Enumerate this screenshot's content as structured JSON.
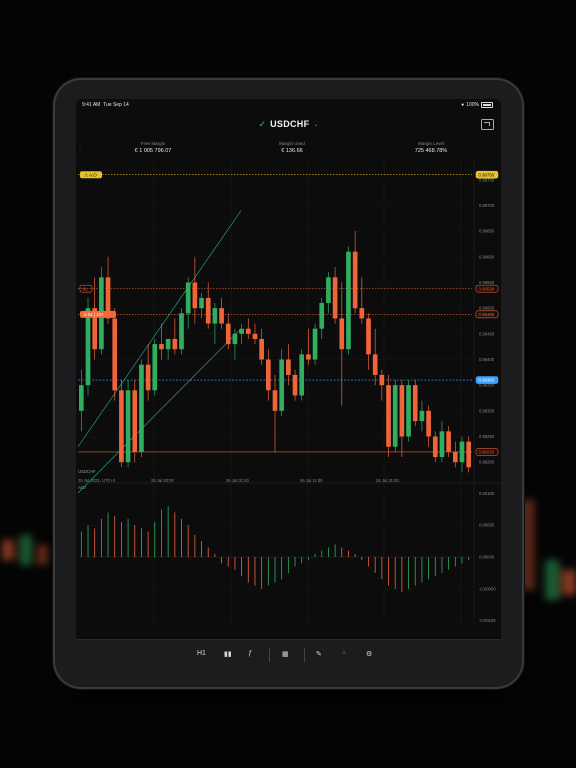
{
  "status": {
    "time": "9:41 AM",
    "date": "Tue Sep 14",
    "battery": "100%"
  },
  "header": {
    "symbol": "USDCHF"
  },
  "metrics": [
    {
      "label": "Free Margin",
      "value": "€ 1 005 796.07"
    },
    {
      "label": "Margin Used",
      "value": "€ 136.66"
    },
    {
      "label": "Margin Level",
      "value": "725 468.78%"
    }
  ],
  "chart_data": {
    "type": "candlestick",
    "price_axis": {
      "ticks": [
        "0.96750",
        "0.96700",
        "0.96650",
        "0.96600",
        "0.96550",
        "0.96500",
        "0.96450",
        "0.96400",
        "0.96350",
        "0.96300",
        "0.96250",
        "0.96200"
      ],
      "min": 0.96175,
      "max": 0.96775
    },
    "time_labels": [
      "25 Jul 2022, UTC+2",
      "25 Jul 20:00",
      "26 Jul 01:00",
      "26 Jul 11:00",
      "26 Jul 21:00"
    ],
    "markers": {
      "alert": {
        "label": "A:O",
        "price": 0.9676,
        "color": "#e6c229"
      },
      "sl": {
        "label": "SL",
        "price": 0.96538,
        "tag": "0.96538",
        "color": "#e0603a"
      },
      "position": {
        "label": "0.01 | 10+",
        "price": 0.96488,
        "tag": "0.96488",
        "color": "#f06a3a"
      },
      "current": {
        "price": 0.9636,
        "tag": "0.96360",
        "color": "#3aa0ff"
      },
      "low": {
        "price": 0.9622,
        "tag": "0.96220",
        "color": "#e0603a"
      }
    },
    "ohlc": [
      [
        0.963,
        0.9638,
        0.9626,
        0.9635
      ],
      [
        0.9635,
        0.9652,
        0.9633,
        0.965
      ],
      [
        0.965,
        0.9656,
        0.964,
        0.9642
      ],
      [
        0.9642,
        0.9658,
        0.9641,
        0.9656
      ],
      [
        0.9656,
        0.966,
        0.9647,
        0.9648
      ],
      [
        0.9648,
        0.965,
        0.9632,
        0.9634
      ],
      [
        0.9634,
        0.9636,
        0.9619,
        0.962
      ],
      [
        0.962,
        0.9636,
        0.9619,
        0.9634
      ],
      [
        0.9634,
        0.9636,
        0.962,
        0.9622
      ],
      [
        0.9622,
        0.964,
        0.9621,
        0.9639
      ],
      [
        0.9639,
        0.9643,
        0.9632,
        0.9634
      ],
      [
        0.9634,
        0.9644,
        0.9633,
        0.9643
      ],
      [
        0.9643,
        0.9647,
        0.964,
        0.9642
      ],
      [
        0.9642,
        0.9644,
        0.964,
        0.9644
      ],
      [
        0.9644,
        0.9648,
        0.9641,
        0.9642
      ],
      [
        0.9642,
        0.965,
        0.9641,
        0.9649
      ],
      [
        0.9649,
        0.9656,
        0.9646,
        0.9655
      ],
      [
        0.9655,
        0.966,
        0.9647,
        0.965
      ],
      [
        0.965,
        0.9653,
        0.9648,
        0.9652
      ],
      [
        0.9652,
        0.9655,
        0.9646,
        0.9647
      ],
      [
        0.9647,
        0.9651,
        0.9643,
        0.965
      ],
      [
        0.965,
        0.9652,
        0.9646,
        0.9647
      ],
      [
        0.9647,
        0.9649,
        0.9642,
        0.9643
      ],
      [
        0.9643,
        0.9646,
        0.964,
        0.9645
      ],
      [
        0.9645,
        0.9647,
        0.9643,
        0.9646
      ],
      [
        0.9646,
        0.9648,
        0.9644,
        0.9645
      ],
      [
        0.9645,
        0.9647,
        0.9643,
        0.9644
      ],
      [
        0.9644,
        0.9646,
        0.9639,
        0.964
      ],
      [
        0.964,
        0.9642,
        0.9632,
        0.9634
      ],
      [
        0.9634,
        0.9637,
        0.9622,
        0.963
      ],
      [
        0.963,
        0.9642,
        0.9629,
        0.964
      ],
      [
        0.964,
        0.9643,
        0.9635,
        0.9637
      ],
      [
        0.9637,
        0.9638,
        0.9632,
        0.9633
      ],
      [
        0.9633,
        0.9642,
        0.9632,
        0.9641
      ],
      [
        0.9641,
        0.9646,
        0.9639,
        0.964
      ],
      [
        0.964,
        0.9647,
        0.9639,
        0.9646
      ],
      [
        0.9646,
        0.9652,
        0.9644,
        0.9651
      ],
      [
        0.9651,
        0.9657,
        0.9649,
        0.9656
      ],
      [
        0.9656,
        0.9658,
        0.9647,
        0.9648
      ],
      [
        0.9648,
        0.9655,
        0.9631,
        0.9642
      ],
      [
        0.9642,
        0.9662,
        0.9641,
        0.9661
      ],
      [
        0.9661,
        0.9665,
        0.9649,
        0.965
      ],
      [
        0.965,
        0.9656,
        0.9647,
        0.9648
      ],
      [
        0.9648,
        0.9649,
        0.9638,
        0.9641
      ],
      [
        0.9641,
        0.9646,
        0.9635,
        0.9637
      ],
      [
        0.9637,
        0.9638,
        0.9632,
        0.9635
      ],
      [
        0.9635,
        0.9637,
        0.9621,
        0.9623
      ],
      [
        0.9623,
        0.9636,
        0.9622,
        0.9635
      ],
      [
        0.9635,
        0.9636,
        0.9621,
        0.9625
      ],
      [
        0.9625,
        0.9636,
        0.9624,
        0.9635
      ],
      [
        0.9635,
        0.9636,
        0.9627,
        0.9628
      ],
      [
        0.9628,
        0.9632,
        0.9626,
        0.963
      ],
      [
        0.963,
        0.9631,
        0.9623,
        0.9625
      ],
      [
        0.9625,
        0.9626,
        0.962,
        0.9621
      ],
      [
        0.9621,
        0.9628,
        0.962,
        0.9626
      ],
      [
        0.9626,
        0.9627,
        0.9621,
        0.9622
      ],
      [
        0.9622,
        0.9624,
        0.9619,
        0.962
      ],
      [
        0.962,
        0.9625,
        0.9618,
        0.9624
      ],
      [
        0.9624,
        0.9625,
        0.9618,
        0.9619
      ]
    ],
    "indicator": {
      "name": "A/O",
      "ticks": [
        "0.00100",
        "0.00050",
        "0.00000",
        "-0.00050",
        "-0.00100"
      ],
      "min": -0.0011,
      "max": 0.0011,
      "values": [
        0.0004,
        0.0005,
        0.00045,
        0.0006,
        0.0007,
        0.00065,
        0.00055,
        0.0006,
        0.0005,
        0.00045,
        0.0004,
        0.00055,
        0.00075,
        0.0008,
        0.0007,
        0.0006,
        0.0005,
        0.00035,
        0.00025,
        0.00015,
        5e-05,
        -0.0001,
        -0.00015,
        -0.0002,
        -0.0003,
        -0.0004,
        -0.00045,
        -0.0005,
        -0.00045,
        -0.0004,
        -0.00035,
        -0.00025,
        -0.00015,
        -0.0001,
        -5e-05,
        5e-05,
        0.0001,
        0.00015,
        0.0002,
        0.00015,
        0.0001,
        5e-05,
        -5e-05,
        -0.00015,
        -0.00025,
        -0.00035,
        -0.00045,
        -0.0005,
        -0.00055,
        -0.0005,
        -0.00045,
        -0.0004,
        -0.00035,
        -0.0003,
        -0.00025,
        -0.0002,
        -0.00015,
        -0.0001,
        -5e-05
      ]
    }
  },
  "toolbar": {
    "timeframe": "H1"
  }
}
